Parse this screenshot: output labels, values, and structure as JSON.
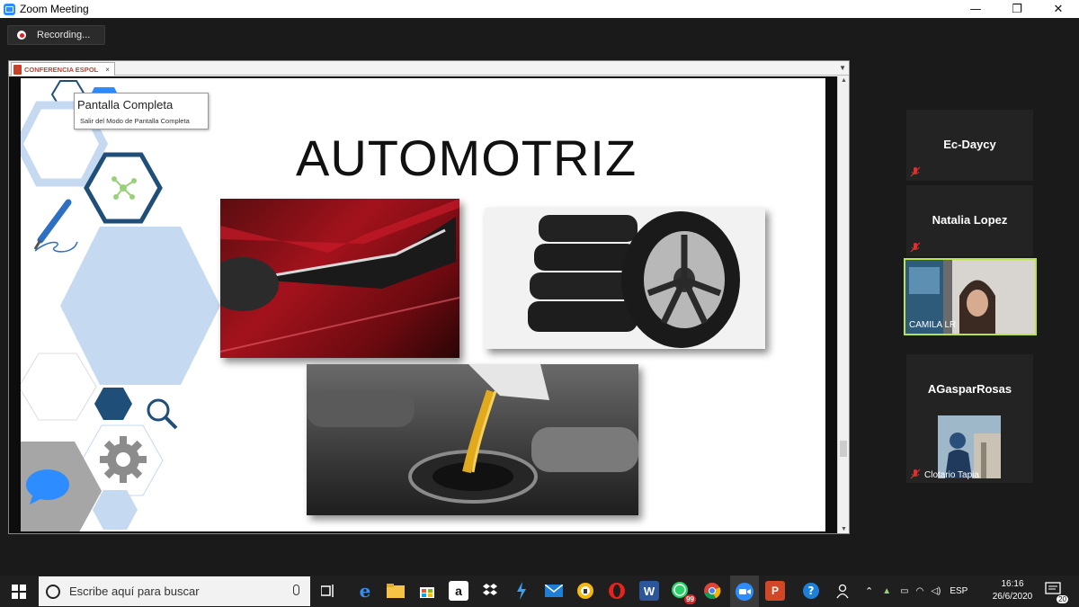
{
  "window": {
    "title": "Zoom Meeting",
    "controls": {
      "minimize": "—",
      "restore": "❐",
      "close": "✕"
    }
  },
  "meeting": {
    "recording_label": "Recording..."
  },
  "presentation": {
    "tab_label": "CONFERENCIA ESPOL",
    "tab_close": "×",
    "slide_title": "AUTOMOTRIZ",
    "tooltip": {
      "title": "Pantalla Completa",
      "subtitle": "Salir del Modo de Pantalla Completa"
    }
  },
  "participants": [
    {
      "name": "Ec-Daycy",
      "muted": true,
      "video": false
    },
    {
      "name": "Natalia Lopez",
      "muted": true,
      "video": false
    },
    {
      "name": "CAMILA LR",
      "muted": false,
      "video": true
    },
    {
      "name": "AGasparRosas",
      "muted": true,
      "video": false
    },
    {
      "name": "Clotario Tapia",
      "muted": true,
      "video": false,
      "avatar": true
    }
  ],
  "colors": {
    "active_speaker_border": "#b9e34a",
    "mic_muted": "#e0302e",
    "zoom_blue": "#2d8cff",
    "hex_light": "#c5d9f0",
    "hex_dark": "#1f4e79"
  },
  "taskbar": {
    "search_placeholder": "Escribe aquí para buscar",
    "whatsapp_badge": "99",
    "language": "ESP",
    "time": "16:16",
    "date": "26/6/2020",
    "notifications_count": "20",
    "pinned_icons": [
      "task-view-icon",
      "edge-icon",
      "file-explorer-icon",
      "store-icon",
      "amazon-icon",
      "dropbox-icon",
      "azure-icon",
      "mail-icon",
      "vpn-icon",
      "opera-icon",
      "word-icon",
      "whatsapp-icon",
      "chrome-icon",
      "zoom-icon",
      "powerpoint-icon",
      "help-icon",
      "people-icon"
    ]
  }
}
